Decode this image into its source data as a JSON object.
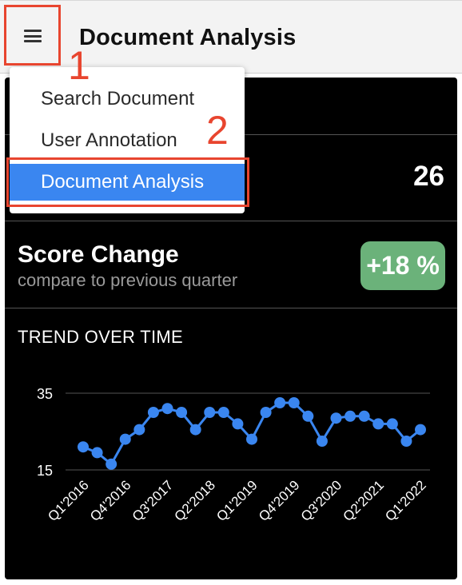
{
  "header": {
    "title": "Document Analysis",
    "menu_icon": "hamburger-menu-icon"
  },
  "menu": {
    "items": [
      {
        "label": "Search Document",
        "active": false
      },
      {
        "label": "User Annotation",
        "active": false
      },
      {
        "label": "Document Analysis",
        "active": true
      }
    ]
  },
  "annotations": {
    "one": "1",
    "two": "2",
    "color": "#e8452f"
  },
  "dashboard": {
    "count_value": "26",
    "score": {
      "title": "Score Change",
      "subtitle": "compare to previous quarter",
      "badge": "+18 %",
      "badge_color": "#6bb27a"
    },
    "trend_title": "TREND OVER TIME"
  },
  "chart_data": {
    "type": "line",
    "x": [
      "Q1'2016",
      "Q2'2016",
      "Q3'2016",
      "Q4'2016",
      "Q1'2017",
      "Q2'2017",
      "Q3'2017",
      "Q4'2017",
      "Q1'2018",
      "Q2'2018",
      "Q3'2018",
      "Q4'2018",
      "Q1'2019",
      "Q2'2019",
      "Q3'2019",
      "Q4'2019",
      "Q1'2020",
      "Q2'2020",
      "Q3'2020",
      "Q4'2020",
      "Q1'2021",
      "Q2'2021",
      "Q3'2021",
      "Q4'2021",
      "Q1'2022",
      "Q2'2022"
    ],
    "x_tick_labels": [
      "Q1'2016",
      "Q4'2016",
      "Q3'2017",
      "Q2'2018",
      "Q1'2019",
      "Q4'2019",
      "Q3'2020",
      "Q2'2021",
      "Q1'2022"
    ],
    "series": [
      {
        "values": [
          21,
          19.5,
          16.5,
          23,
          25.5,
          30,
          31,
          30,
          25.5,
          30,
          30,
          27,
          23,
          30,
          32.5,
          32.5,
          29,
          22.5,
          28.5,
          29,
          29,
          27,
          27,
          22.5,
          25.5
        ],
        "color": "#3a86f0"
      }
    ],
    "yticks": [
      15,
      35
    ],
    "ylim": [
      15,
      35
    ],
    "grid": true
  }
}
